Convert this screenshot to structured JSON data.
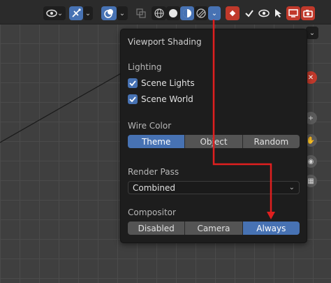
{
  "popover": {
    "title": "Viewport Shading",
    "lighting": {
      "label": "Lighting",
      "scene_lights": "Scene Lights",
      "scene_world": "Scene World"
    },
    "wire_color": {
      "label": "Wire Color",
      "options": [
        "Theme",
        "Object",
        "Random"
      ],
      "selected": "Theme"
    },
    "render_pass": {
      "label": "Render Pass",
      "value": "Combined"
    },
    "compositor": {
      "label": "Compositor",
      "options": [
        "Disabled",
        "Camera",
        "Always"
      ],
      "selected": "Always"
    }
  },
  "colors": {
    "accent": "#4772b3",
    "annotation_arrow": "#e01f1f",
    "rec_red": "#c0392b"
  },
  "icons": [
    "eye-dropdown-icon",
    "gizmo-icon",
    "overlay-icon",
    "xray-icon",
    "wireframe-icon",
    "solid-icon",
    "material-preview-icon",
    "rendered-icon",
    "shading-dropdown-icon",
    "render-region-icon",
    "checkbox-icon",
    "visibility-icon",
    "select-icon",
    "screen-icon",
    "camera-icon"
  ]
}
